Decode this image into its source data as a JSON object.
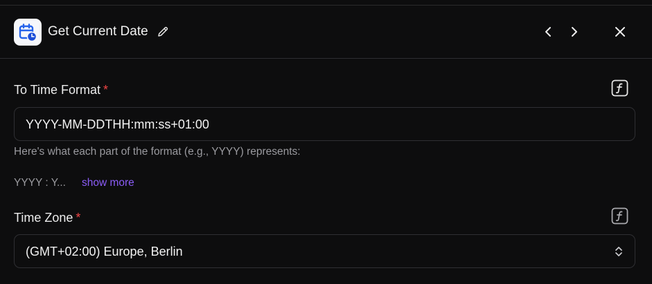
{
  "header": {
    "title": "Get Current Date",
    "app_icon": "calendar-clock-icon",
    "edit_icon": "pencil-icon",
    "prev_icon": "chevron-left-icon",
    "next_icon": "chevron-right-icon",
    "close_icon": "close-icon"
  },
  "fields": {
    "time_format": {
      "label": "To Time Format",
      "required_mark": "*",
      "value": "YYYY-MM-DDTHH:mm:ss+01:00",
      "help": "Here's what each part of the format (e.g., YYYY) represents:",
      "snippet": "YYYY : Y...",
      "show_more": "show more",
      "fx_icon": "function-icon"
    },
    "time_zone": {
      "label": "Time Zone",
      "required_mark": "*",
      "value": "(GMT+02:00) Europe, Berlin",
      "fx_icon": "function-icon",
      "select_icon": "chevrons-up-down-icon"
    }
  },
  "colors": {
    "background": "#0d0d0e",
    "border": "#2f2f33",
    "required": "#ef4444",
    "link": "#8b5cf6",
    "icon_accent": "#2563eb"
  }
}
